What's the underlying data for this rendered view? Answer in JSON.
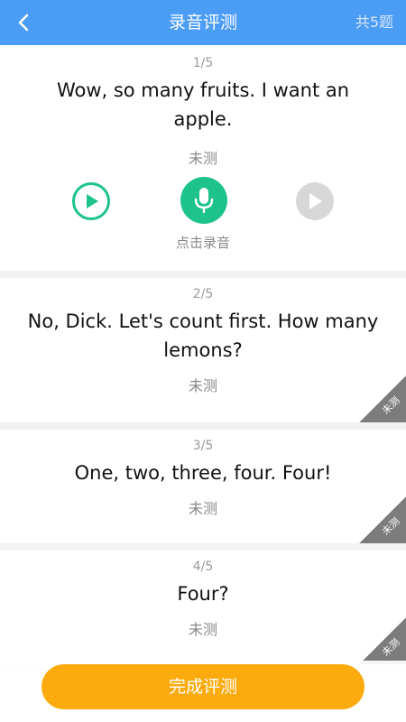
{
  "header": {
    "title": "录音评测",
    "count": "共5题"
  },
  "items": [
    {
      "num": "1/5",
      "sentence": "Wow, so many fruits. I want an apple.",
      "status": "未测",
      "hint": "点击录音"
    },
    {
      "num": "2/5",
      "sentence": "No, Dick. Let's count first. How many lemons?",
      "status": "未测",
      "badge": "未测"
    },
    {
      "num": "3/5",
      "sentence": "One, two, three, four. Four!",
      "status": "未测",
      "badge": "未测"
    },
    {
      "num": "4/5",
      "sentence": "Four?",
      "status": "未测",
      "badge": "未测"
    }
  ],
  "footer": {
    "button": "完成评测"
  },
  "colors": {
    "header": "#4b9cf5",
    "green": "#1ec38c",
    "button": "#fbab0e",
    "badge": "#7c7c7c"
  }
}
